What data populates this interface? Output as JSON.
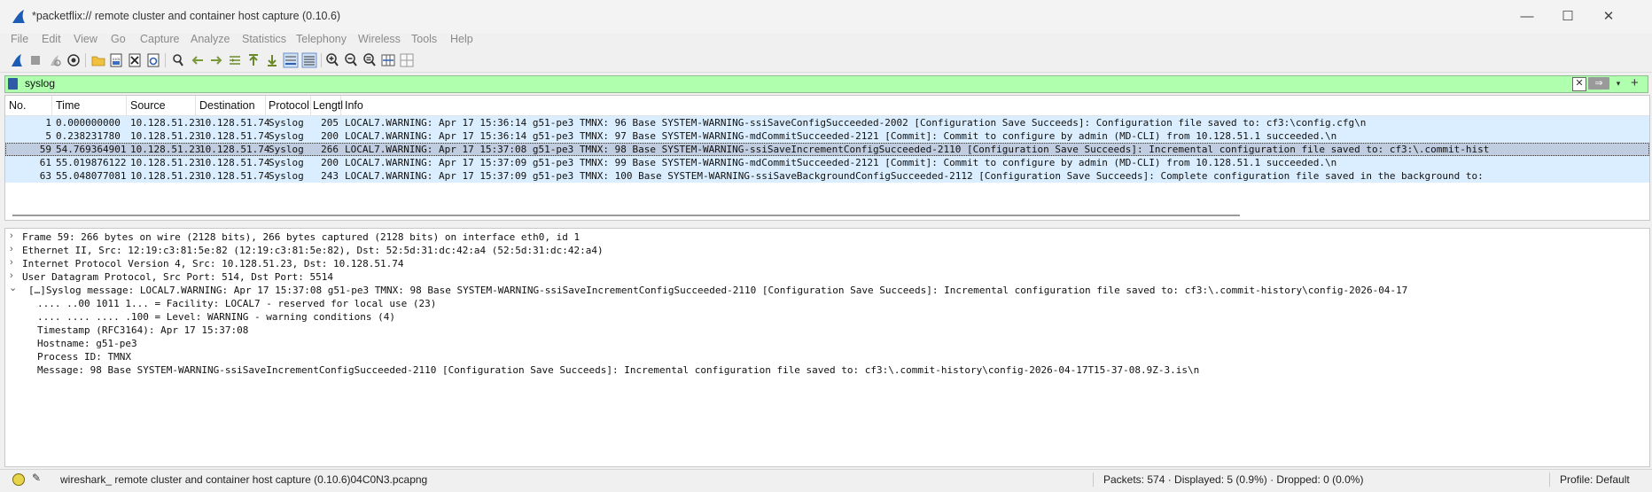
{
  "window": {
    "title": "*packetflix:// remote cluster and container host capture (0.10.6)",
    "minimize_glyph": "—",
    "maximize_glyph": "☐",
    "close_glyph": "✕"
  },
  "menu": [
    "File",
    "Edit",
    "View",
    "Go",
    "Capture",
    "Analyze",
    "Statistics",
    "Telephony",
    "Wireless",
    "Tools",
    "Help"
  ],
  "filter": {
    "value": "syslog",
    "clear_glyph": "✕",
    "apply_glyph": "⇒",
    "dropdown_glyph": "▾",
    "add_glyph": "+"
  },
  "packet_list": {
    "columns": [
      "No.",
      "Time",
      "Source",
      "Destination",
      "Protocol",
      "Lengtl",
      "Info"
    ],
    "rows": [
      {
        "no": "1",
        "time": "0.000000000",
        "source": "10.128.51.23",
        "destination": "10.128.51.74",
        "protocol": "Syslog",
        "length": "205",
        "info": "LOCAL7.WARNING: Apr 17 15:36:14 g51-pe3 TMNX: 96 Base SYSTEM-WARNING-ssiSaveConfigSucceeded-2002 [Configuration Save Succeeds]:  Configuration file saved to: cf3:\\config.cfg\\n",
        "selected": false
      },
      {
        "no": "5",
        "time": "0.238231780",
        "source": "10.128.51.23",
        "destination": "10.128.51.74",
        "protocol": "Syslog",
        "length": "200",
        "info": "LOCAL7.WARNING: Apr 17 15:36:14 g51-pe3 TMNX: 97 Base SYSTEM-WARNING-mdCommitSucceeded-2121 [Commit]:  Commit to configure by admin (MD-CLI) from 10.128.51.1 succeeded.\\n",
        "selected": false
      },
      {
        "no": "59",
        "time": "54.769364901",
        "source": "10.128.51.23",
        "destination": "10.128.51.74",
        "protocol": "Syslog",
        "length": "266",
        "info": "LOCAL7.WARNING: Apr 17 15:37:08 g51-pe3 TMNX: 98 Base SYSTEM-WARNING-ssiSaveIncrementConfigSucceeded-2110 [Configuration Save Succeeds]:  Incremental configuration file saved to: cf3:\\.commit-hist",
        "selected": true
      },
      {
        "no": "61",
        "time": "55.019876122",
        "source": "10.128.51.23",
        "destination": "10.128.51.74",
        "protocol": "Syslog",
        "length": "200",
        "info": "LOCAL7.WARNING: Apr 17 15:37:09 g51-pe3 TMNX: 99 Base SYSTEM-WARNING-mdCommitSucceeded-2121 [Commit]:  Commit to configure by admin (MD-CLI) from 10.128.51.1 succeeded.\\n",
        "selected": false
      },
      {
        "no": "63",
        "time": "55.048077081",
        "source": "10.128.51.23",
        "destination": "10.128.51.74",
        "protocol": "Syslog",
        "length": "243",
        "info": "LOCAL7.WARNING: Apr 17 15:37:09 g51-pe3 TMNX: 100 Base SYSTEM-WARNING-ssiSaveBackgroundConfigSucceeded-2112 [Configuration Save Succeeds]:  Complete configuration file saved in the background to:",
        "selected": false
      }
    ]
  },
  "details": {
    "collapsed_glyph": "›",
    "expanded_glyph": "⌄",
    "lines": [
      {
        "text": "Frame 59: 266 bytes on wire (2128 bits), 266 bytes captured (2128 bits) on interface eth0, id 1",
        "level": 0,
        "state": "collapsed"
      },
      {
        "text": "Ethernet II, Src: 12:19:c3:81:5e:82 (12:19:c3:81:5e:82), Dst: 52:5d:31:dc:42:a4 (52:5d:31:dc:42:a4)",
        "level": 0,
        "state": "collapsed"
      },
      {
        "text": "Internet Protocol Version 4, Src: 10.128.51.23, Dst: 10.128.51.74",
        "level": 0,
        "state": "collapsed"
      },
      {
        "text": "User Datagram Protocol, Src Port: 514, Dst Port: 5514",
        "level": 0,
        "state": "collapsed"
      },
      {
        "text": "[…]Syslog message: LOCAL7.WARNING: Apr 17 15:37:08 g51-pe3 TMNX: 98 Base SYSTEM-WARNING-ssiSaveIncrementConfigSucceeded-2110 [Configuration Save Succeeds]:  Incremental configuration file saved to: cf3:\\.commit-history\\config-2026-04-17",
        "level": 0,
        "state": "expanded"
      },
      {
        "text": ".... ..00 1011 1... = Facility: LOCAL7 - reserved for local use (23)",
        "level": 1,
        "state": "leaf"
      },
      {
        "text": ".... .... .... .100 = Level: WARNING - warning conditions (4)",
        "level": 1,
        "state": "leaf"
      },
      {
        "text": "Timestamp (RFC3164): Apr 17 15:37:08",
        "level": 1,
        "state": "leaf"
      },
      {
        "text": "Hostname: g51-pe3",
        "level": 1,
        "state": "leaf"
      },
      {
        "text": "Process ID: TMNX",
        "level": 1,
        "state": "leaf"
      },
      {
        "text": "Message:  98 Base SYSTEM-WARNING-ssiSaveIncrementConfigSucceeded-2110 [Configuration Save Succeeds]:  Incremental configuration file saved to: cf3:\\.commit-history\\config-2026-04-17T15-37-08.9Z-3.is\\n",
        "level": 1,
        "state": "leaf"
      }
    ]
  },
  "status": {
    "file": "wireshark_ remote cluster and container host capture (0.10.6)04C0N3.pcapng",
    "packets": "Packets: 574 · Displayed: 5 (0.9%) · Dropped: 0 (0.0%)",
    "profile": "Profile: Default",
    "edit_glyph": "✎"
  },
  "colors": {
    "filter_valid_bg": "#afffaf",
    "row_bg": "#daeeff",
    "row_selected_bg": "#c0cde0",
    "brand_blue": "#2e5aa6"
  }
}
